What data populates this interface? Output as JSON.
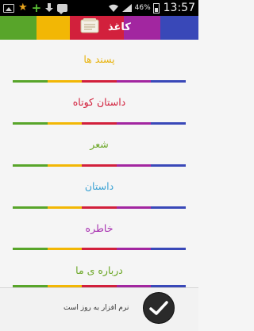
{
  "status_bar": {
    "battery": "46%",
    "time": "13:57",
    "icons": [
      "gallery-icon",
      "star-icon",
      "plus-icon",
      "download-icon",
      "chat-icon",
      "wifi-icon",
      "signal-icon",
      "battery-icon"
    ]
  },
  "header": {
    "title": "کاغذ",
    "icon": "app-logo-icon",
    "colors": [
      "#58a52a",
      "#f2b705",
      "#d2203c",
      "#a226a0",
      "#3948b8"
    ]
  },
  "menu": {
    "items": [
      {
        "label": "پسند ها",
        "color": "#e8b30e"
      },
      {
        "label": "داستان کوتاه",
        "color": "#d2203c"
      },
      {
        "label": "شعر",
        "color": "#6aa624"
      },
      {
        "label": "داستان",
        "color": "#3aa2d4"
      },
      {
        "label": "خاطره",
        "color": "#a72fb0"
      },
      {
        "label": "درباره ی ما",
        "color": "#6aa624"
      }
    ],
    "divider_colors": [
      "#58a52a",
      "#f2b705",
      "#d2203c",
      "#a226a0",
      "#3948b8"
    ]
  },
  "footer": {
    "update_text": "نرم افزار به روز است",
    "check_icon": "checkmark-icon"
  }
}
